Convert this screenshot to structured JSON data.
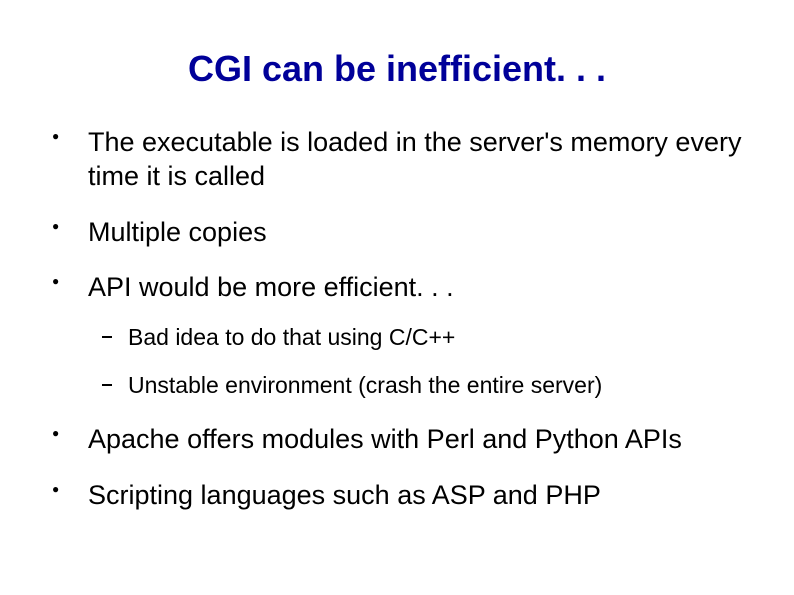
{
  "title": "CGI can be inefficient. . .",
  "bullets": {
    "b0": "The executable is loaded in the server's memory every time it is called",
    "b1": "Multiple copies",
    "b2": "API would be more efficient. . .",
    "b2_subs": {
      "s0": "Bad idea to do that using C/C++",
      "s1": "Unstable environment (crash the entire server)"
    },
    "b3": "Apache offers modules with Perl and Python APIs",
    "b4": "Scripting languages such as ASP and PHP"
  }
}
